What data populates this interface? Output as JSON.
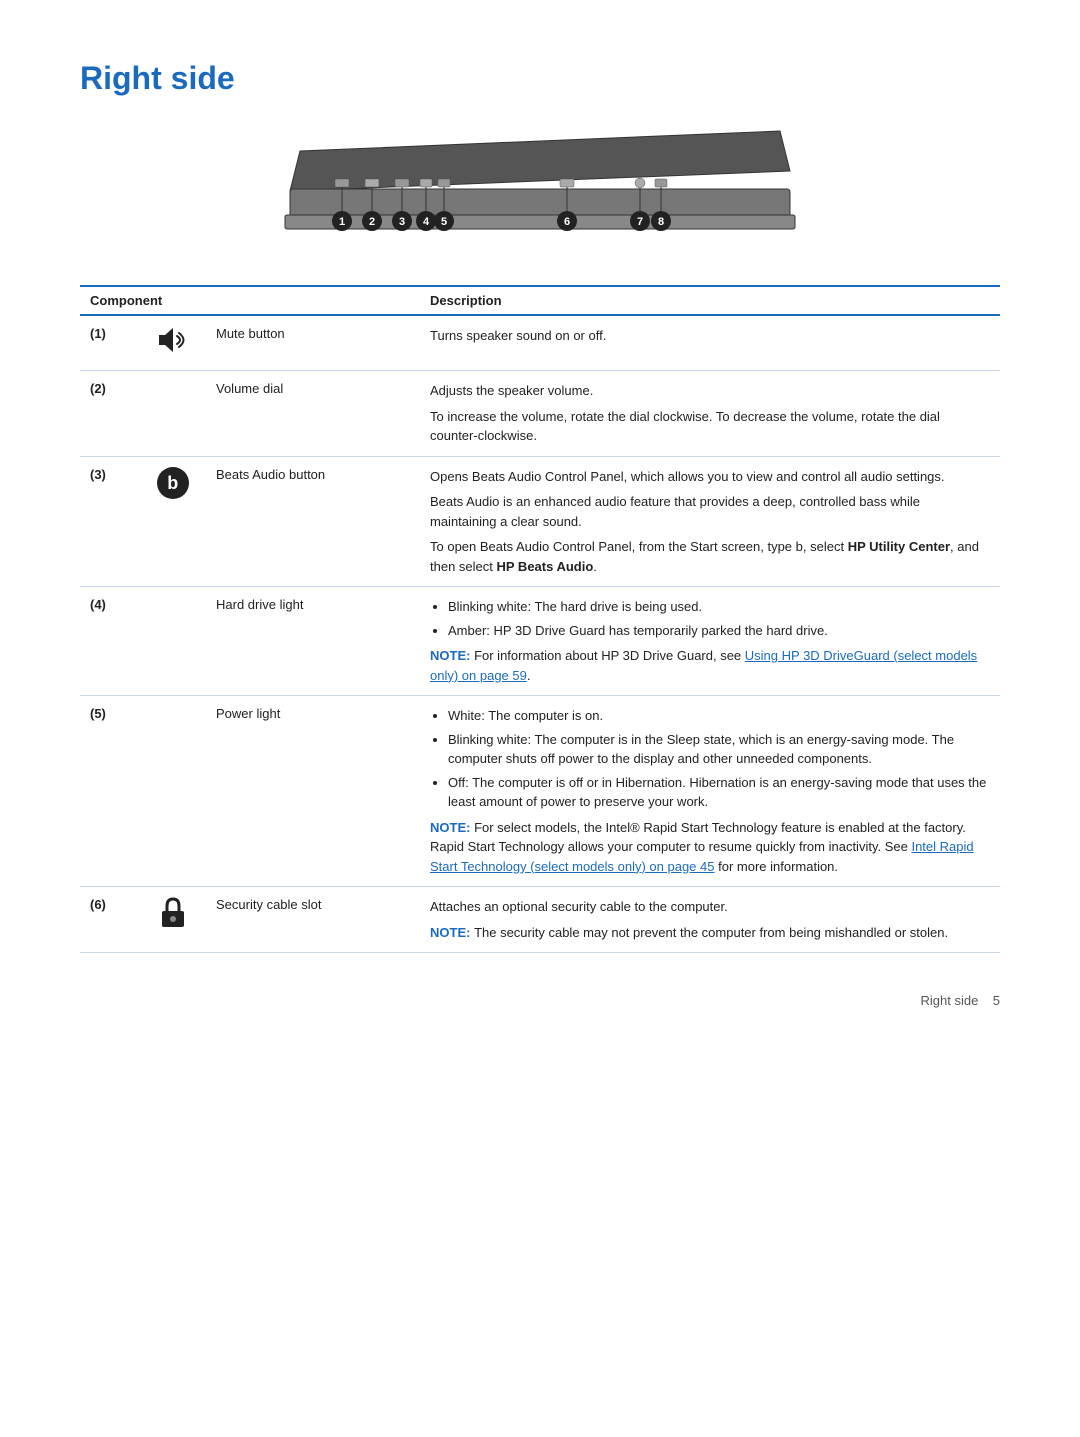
{
  "page": {
    "title": "Right side",
    "footer_label": "Right side",
    "footer_page": "5"
  },
  "table": {
    "col1_header": "Component",
    "col2_header": "Description",
    "rows": [
      {
        "num": "(1)",
        "icon": "mute",
        "name": "Mute button",
        "desc_paragraphs": [
          "Turns speaker sound on or off."
        ],
        "desc_bullets": [],
        "desc_notes": []
      },
      {
        "num": "(2)",
        "icon": "",
        "name": "Volume dial",
        "desc_paragraphs": [
          "Adjusts the speaker volume.",
          "To increase the volume, rotate the dial clockwise. To decrease the volume, rotate the dial counter-clockwise."
        ],
        "desc_bullets": [],
        "desc_notes": []
      },
      {
        "num": "(3)",
        "icon": "beats",
        "name": "Beats Audio button",
        "desc_paragraphs": [
          "Opens Beats Audio Control Panel, which allows you to view and control all audio settings.",
          "Beats Audio is an enhanced audio feature that provides a deep, controlled bass while maintaining a clear sound.",
          "To open Beats Audio Control Panel, from the Start screen, type b, select HP Utility Center, and then select HP Beats Audio."
        ],
        "desc_bullets": [],
        "desc_notes": [],
        "desc_para3_parts": [
          {
            "text": "To open Beats Audio Control Panel, from the Start screen, type b, select ",
            "bold": false
          },
          {
            "text": "HP Utility Center",
            "bold": true
          },
          {
            "text": ", and then select ",
            "bold": false
          },
          {
            "text": "HP Beats Audio",
            "bold": true
          },
          {
            "text": ".",
            "bold": false
          }
        ]
      },
      {
        "num": "(4)",
        "icon": "",
        "name": "Hard drive light",
        "desc_paragraphs": [],
        "desc_bullets": [
          "Blinking white: The hard drive is being used.",
          "Amber: HP 3D Drive Guard has temporarily parked the hard drive."
        ],
        "desc_notes": [
          {
            "label": "NOTE:",
            "text": "For information about HP 3D Drive Guard, see ",
            "link": "Using HP 3D DriveGuard (select models only) on page 59",
            "after": "."
          }
        ]
      },
      {
        "num": "(5)",
        "icon": "",
        "name": "Power light",
        "desc_paragraphs": [],
        "desc_bullets": [
          "White: The computer is on.",
          "Blinking white: The computer is in the Sleep state, which is an energy-saving mode. The computer shuts off power to the display and other unneeded components.",
          "Off: The computer is off or in Hibernation. Hibernation is an energy-saving mode that uses the least amount of power to preserve your work."
        ],
        "desc_notes": [
          {
            "label": "NOTE:",
            "text": "For select models, the Intel® Rapid Start Technology feature is enabled at the factory. Rapid Start Technology allows your computer to resume quickly from inactivity. See ",
            "link": "Intel Rapid Start Technology (select models only) on page 45",
            "after": " for more information."
          }
        ]
      },
      {
        "num": "(6)",
        "icon": "lock",
        "name": "Security cable slot",
        "desc_paragraphs": [
          "Attaches an optional security cable to the computer."
        ],
        "desc_bullets": [],
        "desc_notes": [
          {
            "label": "NOTE:",
            "text": "The security cable may not prevent the computer from being mishandled or stolen.",
            "link": "",
            "after": ""
          }
        ]
      }
    ]
  }
}
